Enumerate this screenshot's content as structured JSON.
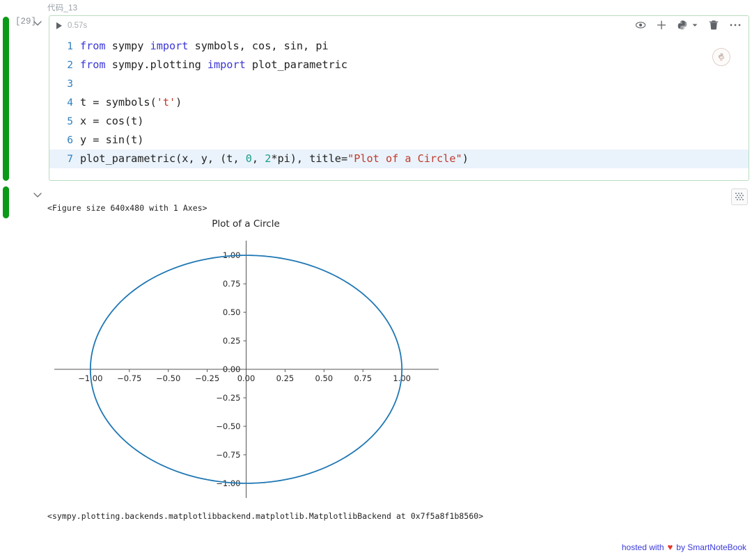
{
  "cell": {
    "label": "代码_13",
    "execution_count": "[29]",
    "elapsed": "0.57s",
    "status_color": "#0b9a17",
    "border_color": "#b9dcc0",
    "toolbar": {
      "icons": [
        {
          "name": "eye-icon",
          "title": "hide"
        },
        {
          "name": "plus-icon",
          "title": "add"
        },
        {
          "name": "python-kernel-icon",
          "title": "kernel"
        },
        {
          "name": "chevron-down-icon",
          "title": "kernel menu"
        },
        {
          "name": "trash-icon",
          "title": "delete"
        },
        {
          "name": "ellipsis-icon",
          "title": "more"
        }
      ]
    },
    "code_lines": [
      {
        "n": "1",
        "tokens": [
          {
            "t": "from ",
            "c": "kw"
          },
          {
            "t": "sympy ",
            "c": "ct"
          },
          {
            "t": "import ",
            "c": "kw"
          },
          {
            "t": "symbols, cos, sin, pi",
            "c": "ct"
          }
        ]
      },
      {
        "n": "2",
        "tokens": [
          {
            "t": "from ",
            "c": "kw"
          },
          {
            "t": "sympy.plotting ",
            "c": "ct"
          },
          {
            "t": "import ",
            "c": "kw"
          },
          {
            "t": "plot_parametric",
            "c": "ct"
          }
        ]
      },
      {
        "n": "3",
        "tokens": []
      },
      {
        "n": "4",
        "tokens": [
          {
            "t": "t = symbols(",
            "c": "ct"
          },
          {
            "t": "'t'",
            "c": "str"
          },
          {
            "t": ")",
            "c": "ct"
          }
        ]
      },
      {
        "n": "5",
        "tokens": [
          {
            "t": "x = cos(t)",
            "c": "ct"
          }
        ]
      },
      {
        "n": "6",
        "tokens": [
          {
            "t": "y = sin(t)",
            "c": "ct"
          }
        ]
      },
      {
        "n": "7",
        "highlight": true,
        "tokens": [
          {
            "t": "plot_parametric(x, y, (t, ",
            "c": "ct"
          },
          {
            "t": "0",
            "c": "num"
          },
          {
            "t": ", ",
            "c": "ct"
          },
          {
            "t": "2",
            "c": "num"
          },
          {
            "t": "*pi), title=",
            "c": "ct"
          },
          {
            "t": "\"Plot of a Circle\"",
            "c": "str"
          },
          {
            "t": ")",
            "c": "ct"
          }
        ]
      }
    ]
  },
  "output": {
    "figure_repr": "<Figure size 640x480 with 1 Axes>",
    "backend_repr": "<sympy.plotting.backends.matplotlibbackend.matplotlib.MatplotlibBackend at 0x7f5a8f1b8560>",
    "collapse_icon": "grid-icon"
  },
  "chart_data": {
    "type": "line",
    "title": "Plot of a Circle",
    "xlabel": "",
    "ylabel": "",
    "xlim": [
      -1.12,
      1.12
    ],
    "ylim": [
      -1.08,
      1.08
    ],
    "xticks": [
      "-1.00",
      "-0.75",
      "-0.50",
      "-0.25",
      "0.00",
      "0.25",
      "0.50",
      "0.75",
      "1.00"
    ],
    "xtick_values": [
      -1.0,
      -0.75,
      -0.5,
      -0.25,
      0.0,
      0.25,
      0.5,
      0.75,
      1.0
    ],
    "yticks": [
      "1.00",
      "0.75",
      "0.50",
      "0.25",
      "0.00",
      "-0.25",
      "-0.50",
      "-0.75",
      "-1.00"
    ],
    "ytick_values": [
      1.0,
      0.75,
      0.5,
      0.25,
      0.0,
      -0.25,
      -0.5,
      -0.75,
      -1.0
    ],
    "grid": false,
    "legend": false,
    "spines": "centered",
    "series": [
      {
        "name": "(cos(t), sin(t))",
        "color": "#1f77b4",
        "linewidth": 1.8,
        "parametric": {
          "x": "cos(t)",
          "y": "sin(t)",
          "t_start": 0,
          "t_end": 6.283185307179586
        },
        "points": 361
      }
    ]
  },
  "footer": {
    "prefix": "hosted with",
    "heart": "♥",
    "suffix": "by SmartNoteBook",
    "color": "#3b3bdb",
    "heart_color": "#e8342b"
  }
}
